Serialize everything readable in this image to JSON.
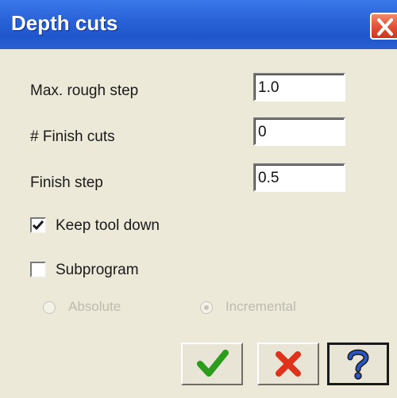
{
  "window": {
    "title": "Depth cuts"
  },
  "fields": [
    {
      "label": "Max. rough step",
      "value": "1.0"
    },
    {
      "label": "# Finish cuts",
      "value": "0"
    },
    {
      "label": "Finish step",
      "value": "0.5"
    }
  ],
  "options": {
    "keep_tool_down": {
      "label": "Keep tool down",
      "checked": true
    },
    "subprogram": {
      "label": "Subprogram",
      "checked": false
    },
    "mode": {
      "absolute_label": "Absolute",
      "incremental_label": "Incremental",
      "selected": "Incremental",
      "enabled": false
    }
  },
  "buttons": {
    "ok_icon": "checkmark-icon",
    "cancel_icon": "x-icon",
    "help_icon": "question-icon"
  },
  "colors": {
    "titlebar": "#2a63d8",
    "ok_green": "#2c9c1c",
    "cancel_red": "#e0321a",
    "help_blue": "#2a57c8"
  }
}
